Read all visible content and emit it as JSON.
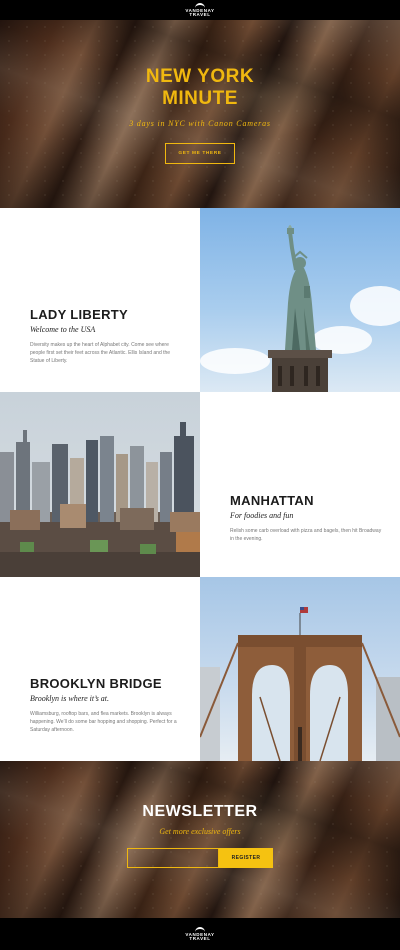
{
  "brand": {
    "line1": "VANDENAY",
    "line2": "TRAVEL"
  },
  "hero": {
    "title_line1": "NEW YORK",
    "title_line2": "MINUTE",
    "subtitle": "3 days in NYC with Canon Cameras",
    "cta_label": "GET ME THERE"
  },
  "sections": [
    {
      "title": "LADY LIBERTY",
      "subtitle": "Welcome to the USA",
      "description": "Diversity makes up the heart of Alphabet city. Come see where people first set their feet across the Atlantic. Ellis Island and the Statue of Liberty."
    },
    {
      "title": "MANHATTAN",
      "subtitle": "For foodies and fun",
      "description": "Relish some carb overload with pizza and bagels, then hit Broadway in the evening."
    },
    {
      "title": "BROOKLYN BRIDGE",
      "subtitle": "Brooklyn is where it’s at.",
      "description": "Williamsburg, rooftop bars, and flea markets. Brooklyn is always happening. We’ll do some bar hopping and shopping. Perfect for a Saturday afternoon."
    }
  ],
  "newsletter": {
    "title": "NEWSLETTER",
    "subtitle": "Get more exclusive offers",
    "input_value": "",
    "button_label": "REGISTER"
  },
  "colors": {
    "accent": "#f0b80f",
    "button": "#f5c211",
    "bar": "#000000"
  }
}
